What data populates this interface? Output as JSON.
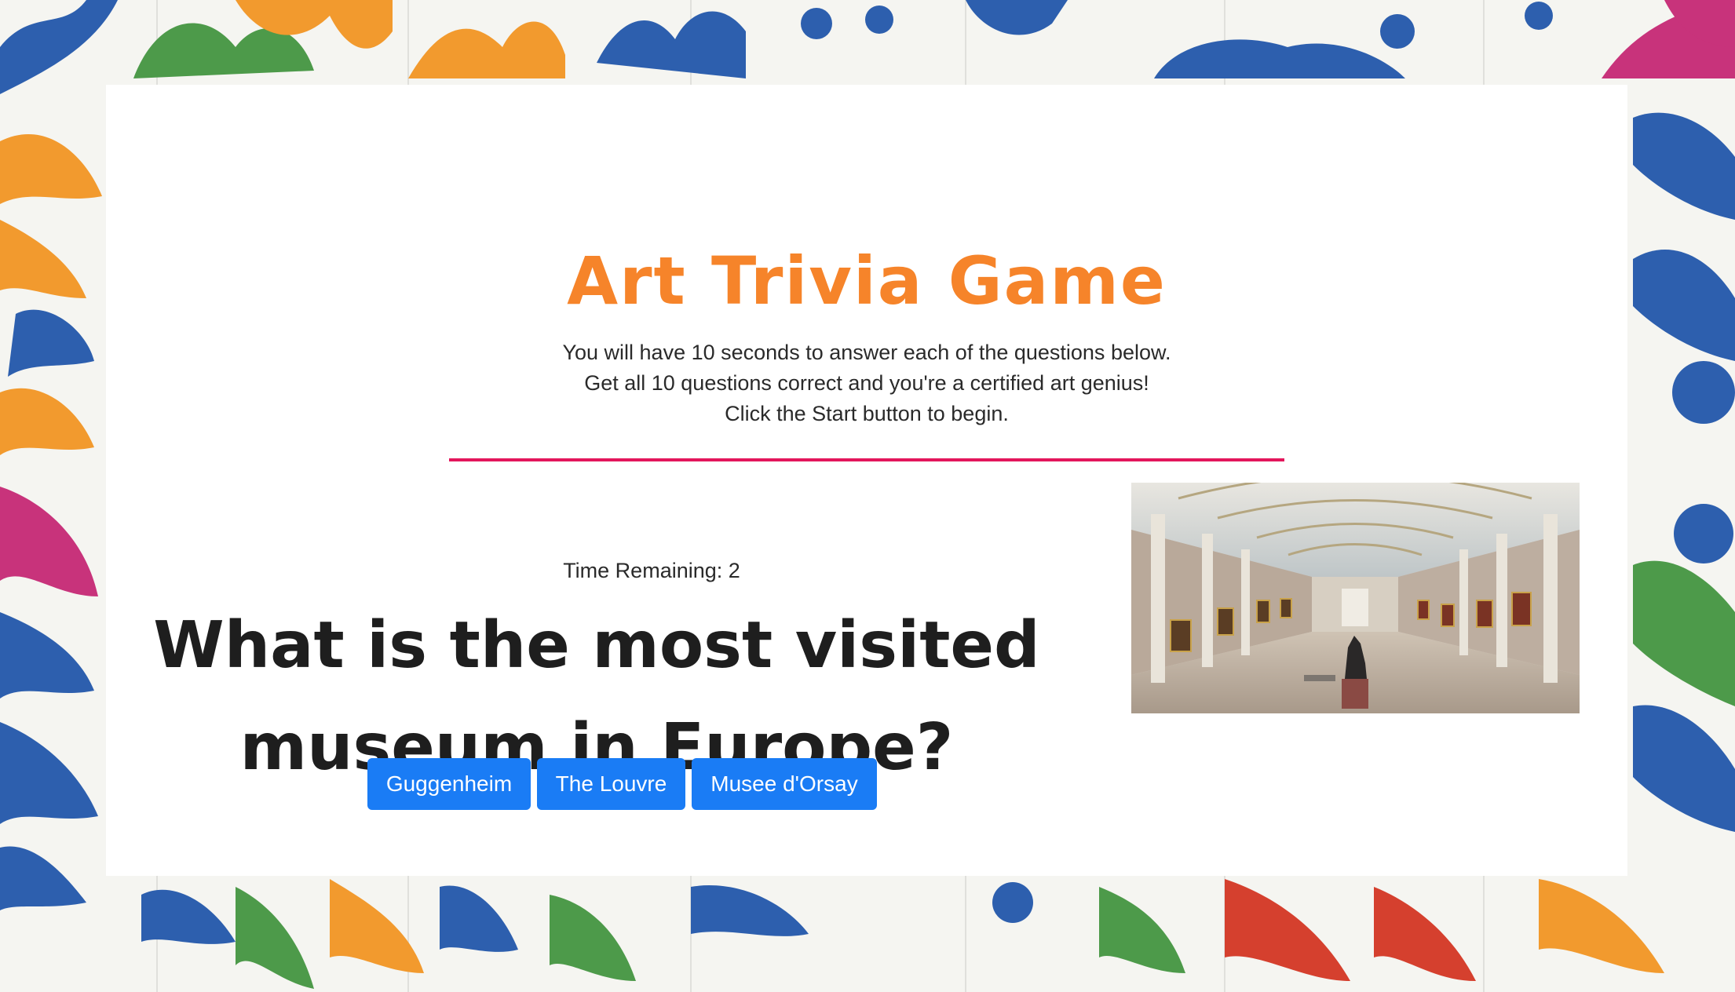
{
  "header": {
    "title": "Art Trivia Game",
    "instructions": [
      "You will have 10 seconds to answer each of the questions below.",
      "Get all 10 questions correct and you're a certified art genius!",
      "Click the Start button to begin."
    ]
  },
  "game": {
    "timer_label": "Time Remaining:",
    "time_remaining": "2",
    "question": "What is the most visited museum in Europe?",
    "answers": [
      "Guggenheim",
      "The Louvre",
      "Musee d'Orsay"
    ],
    "image_icon": "museum-gallery-photo"
  },
  "colors": {
    "title": "#f6842a",
    "divider": "#e3165b",
    "button": "#1a7cf5",
    "card": "#ffffff"
  }
}
